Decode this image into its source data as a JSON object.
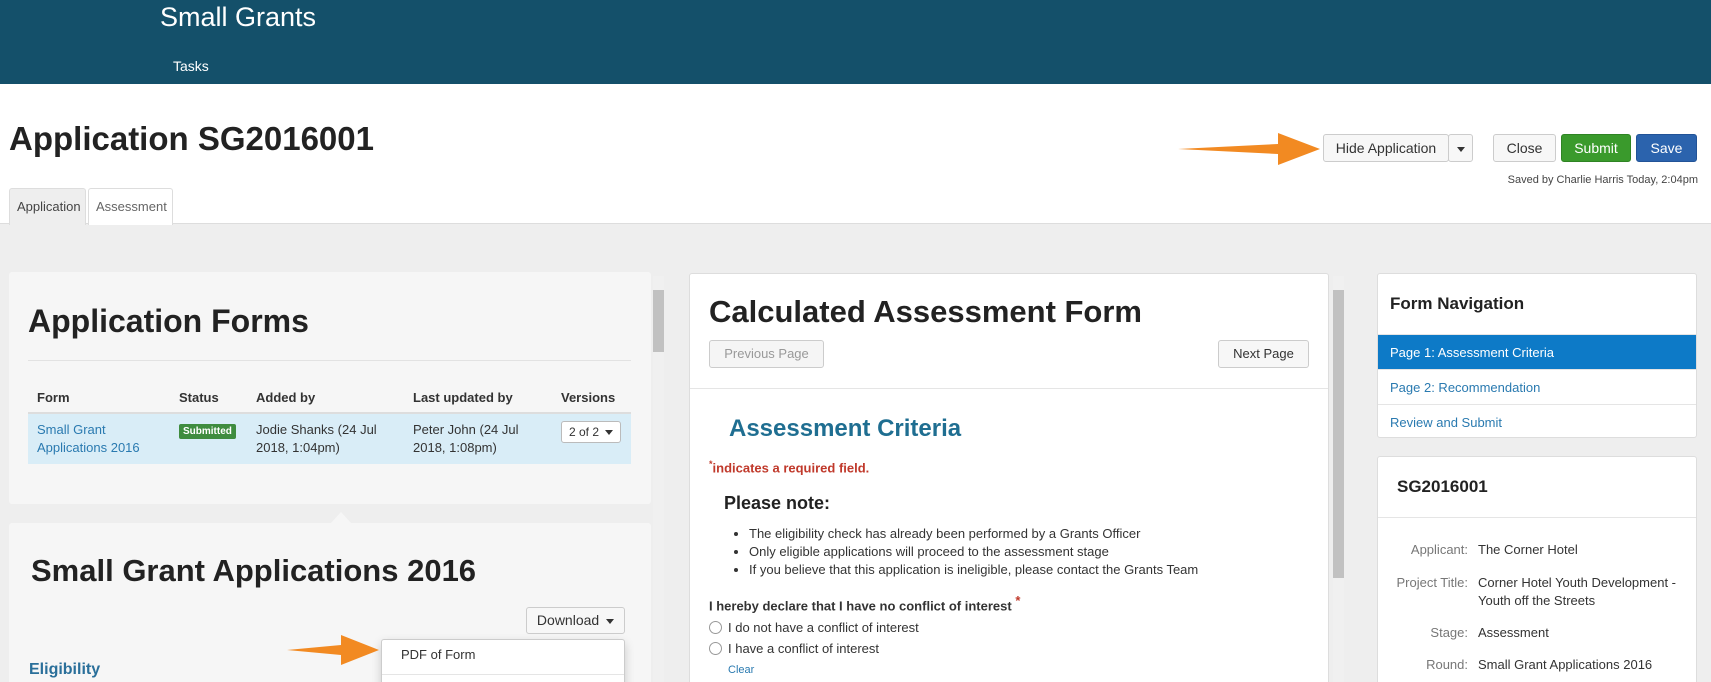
{
  "app": {
    "title": "Small Grants",
    "nav": [
      "Tasks"
    ]
  },
  "page": {
    "title": "Application SG2016001",
    "tabs": [
      "Application",
      "Assessment"
    ],
    "actions": {
      "hide_application": "Hide Application",
      "close": "Close",
      "submit": "Submit",
      "save": "Save",
      "saved_status": "Saved by Charlie Harris Today, 2:04pm"
    }
  },
  "colors": {
    "header": "#14506a",
    "accent_blue": "#0d7ac7",
    "green": "#3a9a2c",
    "save_blue": "#2b63ad",
    "arrow": "#f28a22"
  },
  "application_forms": {
    "heading": "Application Forms",
    "columns": [
      "Form",
      "Status",
      "Added by",
      "Last updated by",
      "Versions"
    ],
    "rows": [
      {
        "form": "Small Grant Applications 2016",
        "status": "Submitted",
        "added_by": "Jodie Shanks (24 Jul 2018, 1:04pm)",
        "updated_by": "Peter John (24 Jul 2018, 1:08pm)",
        "versions": "2 of 2"
      }
    ]
  },
  "form_detail": {
    "heading": "Small Grant Applications 2016",
    "download_label": "Download",
    "download_menu": [
      "PDF of Form"
    ],
    "section": "Eligibility"
  },
  "assessment": {
    "title": "Calculated Assessment Form",
    "prev": "Previous Page",
    "next": "Next Page",
    "section_title": "Assessment Criteria",
    "required_note": "indicates a required field.",
    "required_mark": "*",
    "note_heading": "Please note:",
    "notes": [
      "The eligibility check has already been performed by a Grants Officer",
      "Only eligible applications will proceed to the assessment stage",
      "If you believe that this application is ineligible, please contact the Grants Team"
    ],
    "question": "I hereby declare that I have no conflict of interest",
    "options": [
      "I do not have a conflict of interest",
      "I have a conflict of interest"
    ],
    "clear": "Clear"
  },
  "form_navigation": {
    "heading": "Form Navigation",
    "items": [
      "Page 1: Assessment Criteria",
      "Page 2: Recommendation",
      "Review and Submit"
    ]
  },
  "summary": {
    "id": "SG2016001",
    "fields": [
      {
        "label": "Applicant:",
        "value": "The Corner Hotel"
      },
      {
        "label": "Project Title:",
        "value": "Corner Hotel Youth Development - Youth off the Streets"
      },
      {
        "label": "Stage:",
        "value": "Assessment"
      },
      {
        "label": "Round:",
        "value": "Small Grant Applications 2016"
      }
    ]
  }
}
